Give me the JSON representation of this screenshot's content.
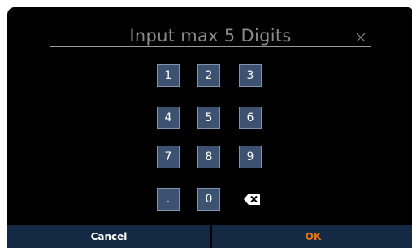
{
  "input": {
    "placeholder": "Input max 5 Digits",
    "clear_icon": "close-icon"
  },
  "keypad": {
    "keys": [
      "1",
      "2",
      "3",
      "4",
      "5",
      "6",
      "7",
      "8",
      "9",
      ".",
      "0"
    ],
    "backspace_icon": "backspace-icon"
  },
  "footer": {
    "cancel_label": "Cancel",
    "ok_label": "OK"
  },
  "colors": {
    "ok_text": "#e8760f",
    "key_bg": "#3d5270",
    "footer_bg": "#142943"
  }
}
